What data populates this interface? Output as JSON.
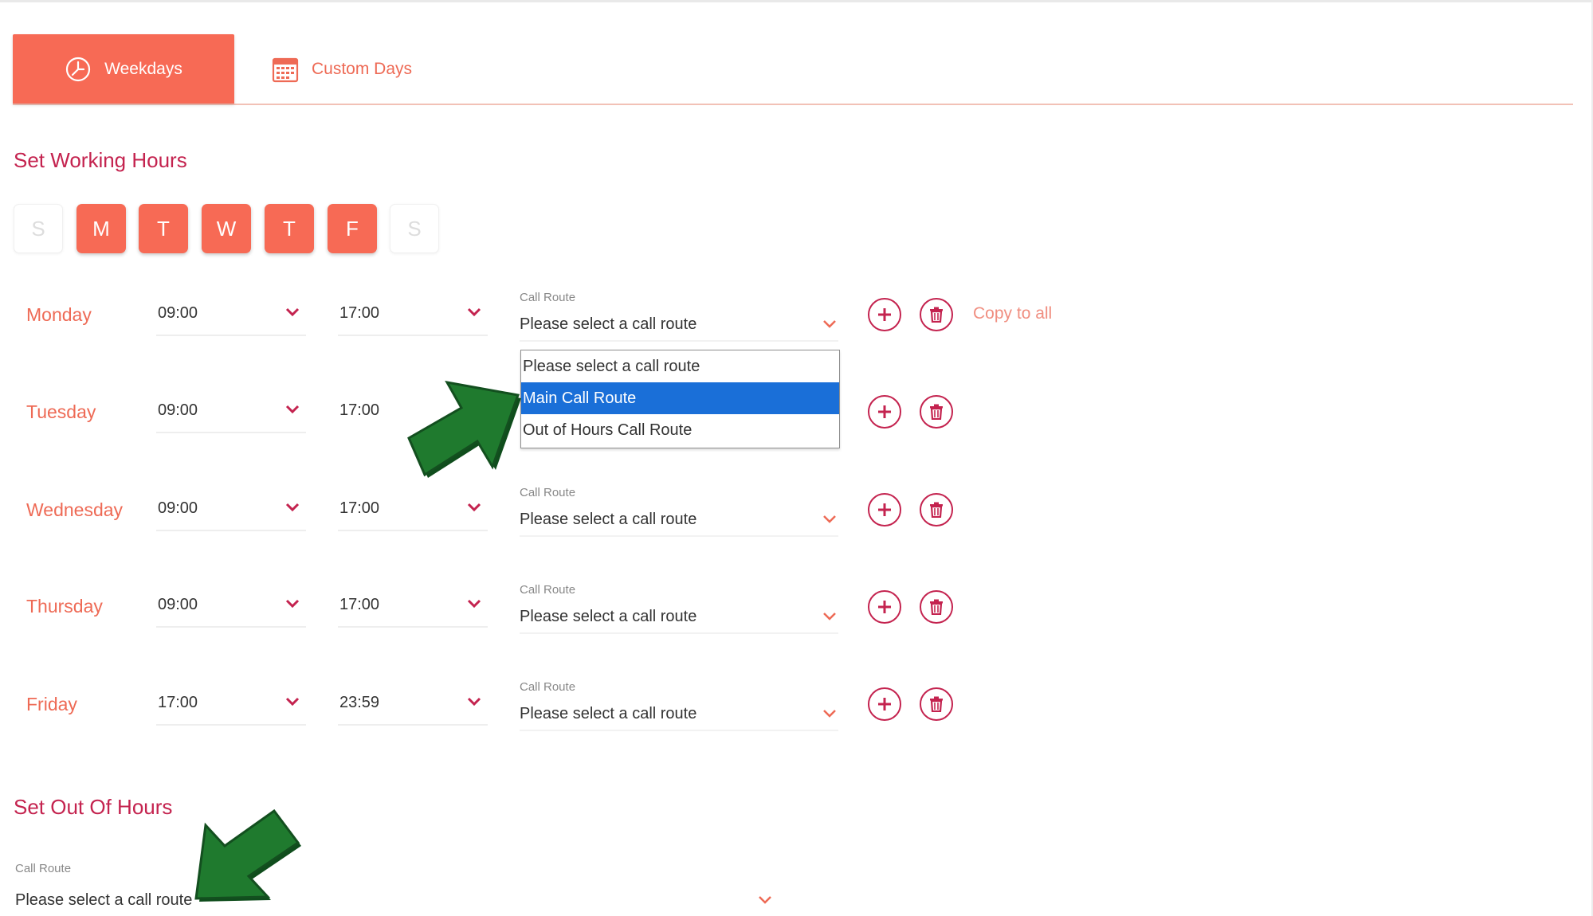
{
  "tabs": [
    {
      "label": "Weekdays",
      "icon": "clock-icon",
      "active": true
    },
    {
      "label": "Custom Days",
      "icon": "calendar-icon",
      "active": false
    }
  ],
  "working_hours": {
    "title": "Set Working Hours",
    "days": [
      {
        "letter": "S",
        "on": false
      },
      {
        "letter": "M",
        "on": true
      },
      {
        "letter": "T",
        "on": true
      },
      {
        "letter": "W",
        "on": true
      },
      {
        "letter": "T",
        "on": true
      },
      {
        "letter": "F",
        "on": true
      },
      {
        "letter": "S",
        "on": false
      }
    ],
    "rows": [
      {
        "day": "Monday",
        "start": "09:00",
        "end": "17:00",
        "route_label": "Call Route",
        "route_value": "Please select a call route"
      },
      {
        "day": "Tuesday",
        "start": "09:00",
        "end": "17:00",
        "route_label": "",
        "route_value": ""
      },
      {
        "day": "Wednesday",
        "start": "09:00",
        "end": "17:00",
        "route_label": "Call Route",
        "route_value": "Please select a call route"
      },
      {
        "day": "Thursday",
        "start": "09:00",
        "end": "17:00",
        "route_label": "Call Route",
        "route_value": "Please select a call route"
      },
      {
        "day": "Friday",
        "start": "17:00",
        "end": "23:59",
        "route_label": "Call Route",
        "route_value": "Please select a call route"
      }
    ],
    "copy_to_all": "Copy to all"
  },
  "route_dropdown": {
    "options": [
      "Please select a call route",
      "Main Call Route",
      "Out of Hours Call Route"
    ],
    "highlighted": "Main Call Route"
  },
  "out_of_hours": {
    "title": "Set Out Of Hours",
    "route_label": "Call Route",
    "route_value": "Please select a call route"
  },
  "colors": {
    "accent": "#f76a55",
    "heading": "#c4234f",
    "selection": "#1a6fd8",
    "annotation_arrow": "#1f7a2e"
  }
}
